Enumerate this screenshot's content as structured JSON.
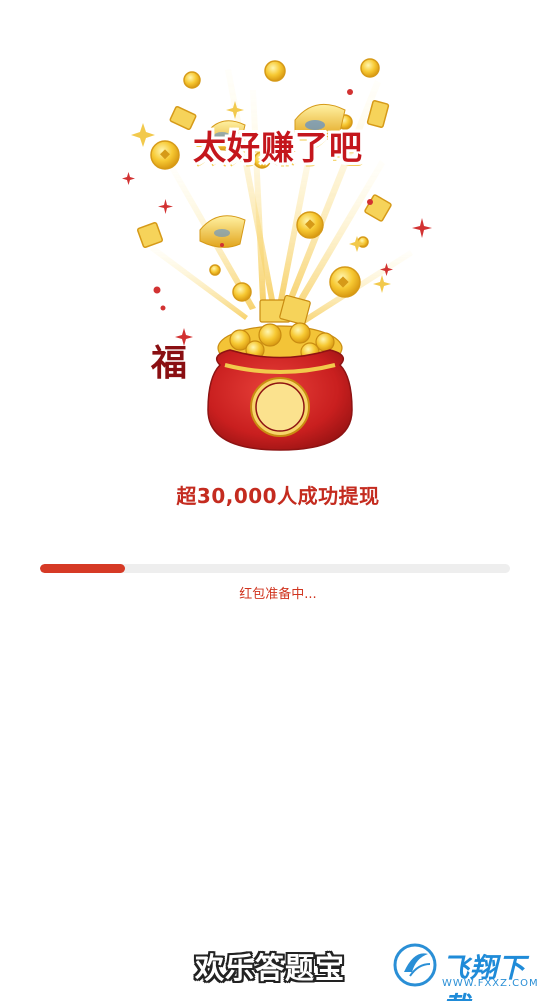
{
  "hero": {
    "headline": "太好赚了吧",
    "bag_character": "福",
    "illustration_icon": "lucky-money-bag-icon"
  },
  "stats_text": "超30,000人成功提现",
  "progress": {
    "fraction": 0.18,
    "color": "#d63a26",
    "track_color": "#eeeeee",
    "status": "红包准备中..."
  },
  "footer": {
    "app_name": "欢乐答题宝"
  },
  "watermark": {
    "text": "飞翔下载",
    "url": "WWW.FXXZ.COM",
    "icon": "fxxz-logo-icon"
  },
  "colors": {
    "accent_red": "#c4161c",
    "gold": "#f2c94c"
  }
}
